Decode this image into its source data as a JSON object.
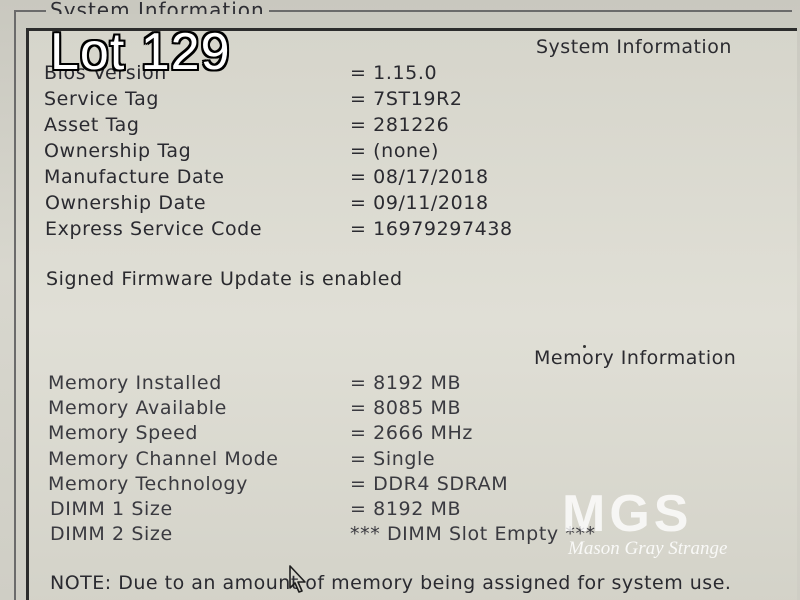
{
  "frame": {
    "title": "System Information"
  },
  "overlay": {
    "lot_label": "Lot 129"
  },
  "system": {
    "title": "System Information",
    "rows": [
      {
        "label": "Bios Version",
        "value": "= 1.15.0"
      },
      {
        "label": "Service Tag",
        "value": "= 7ST19R2"
      },
      {
        "label": "Asset Tag",
        "value": "= 281226"
      },
      {
        "label": "Ownership Tag",
        "value": "= (none)"
      },
      {
        "label": "Manufacture Date",
        "value": "= 08/17/2018"
      },
      {
        "label": "Ownership Date",
        "value": "= 09/11/2018"
      },
      {
        "label": "Express Service Code",
        "value": "= 16979297438"
      }
    ],
    "notice": "Signed Firmware Update is enabled"
  },
  "memory": {
    "title": "Memory Information",
    "rows": [
      {
        "label": "Memory Installed",
        "value": "= 8192 MB"
      },
      {
        "label": "Memory Available",
        "value": "= 8085 MB"
      },
      {
        "label": "Memory Speed",
        "value": "= 2666 MHz"
      },
      {
        "label": "Memory Channel Mode",
        "value": "= Single"
      },
      {
        "label": "Memory Technology",
        "value": "= DDR4 SDRAM"
      },
      {
        "label": "DIMM 1 Size",
        "value": "= 8192 MB"
      },
      {
        "label": "DIMM 2 Size",
        "value": "*** DIMM Slot Empty ***"
      }
    ]
  },
  "note": "NOTE: Due to an amount of memory being assigned for system use.",
  "watermark": {
    "logo": "MGS",
    "text": "Mason Gray Strange"
  },
  "icons": {
    "cursor": "mouse-pointer-icon"
  }
}
